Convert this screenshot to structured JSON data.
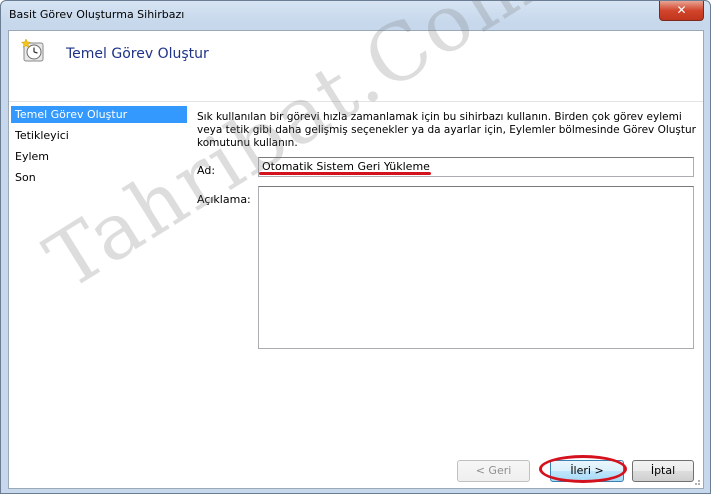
{
  "window": {
    "title": "Basit Görev Oluşturma Sihirbazı",
    "close_glyph": "✕"
  },
  "header": {
    "title": "Temel Görev Oluştur",
    "icon": "clock-star-icon"
  },
  "nav": {
    "items": [
      {
        "label": "Temel Görev Oluştur",
        "active": true
      },
      {
        "label": "Tetikleyici",
        "active": false
      },
      {
        "label": "Eylem",
        "active": false
      },
      {
        "label": "Son",
        "active": false
      }
    ]
  },
  "main": {
    "description": "Sık kullanılan bir görevi hızla zamanlamak için bu sihirbazı kullanın. Birden çok görev eylemi veya tetik gibi daha gelişmiş seçenekler ya da ayarlar için, Eylemler bölmesinde Görev Oluştur komutunu kullanın.",
    "name_label": "Ad:",
    "name_value": "Otomatik Sistem Geri Yükleme",
    "description_label": "Açıklama:",
    "description_value": ""
  },
  "buttons": {
    "back": "< Geri",
    "next": "İleri >",
    "cancel": "İptal"
  },
  "watermark": "Tahribat.Com",
  "colors": {
    "accent": "#3399ff",
    "header_title": "#1e3287",
    "annotation_red": "#d4121e"
  }
}
